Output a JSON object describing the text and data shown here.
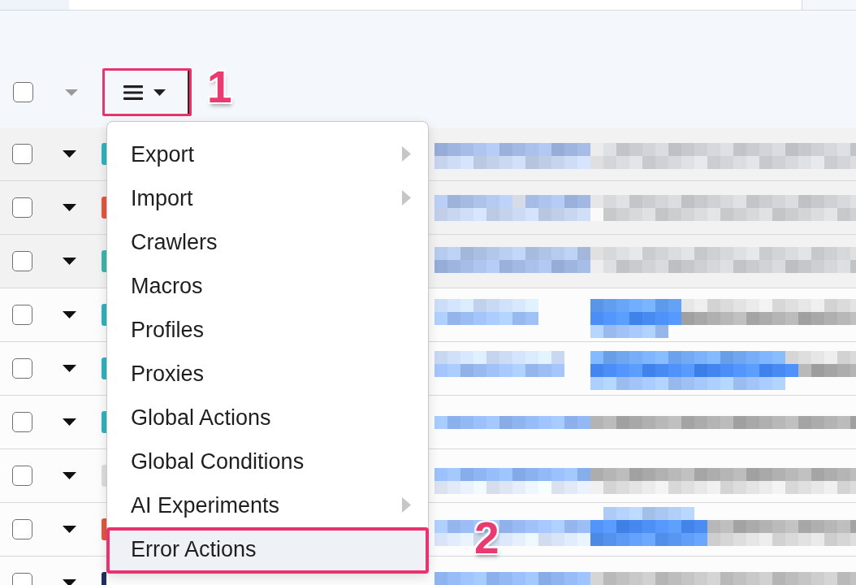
{
  "toolbar": {
    "select_all": {
      "checked": false
    },
    "expand_all": {
      "disabled": true
    },
    "menu_button": {
      "expanded": true,
      "annotation": "1"
    }
  },
  "menu": {
    "items": [
      {
        "label": "Export",
        "submenu": true,
        "selected": false
      },
      {
        "label": "Import",
        "submenu": true,
        "selected": false
      },
      {
        "label": "Crawlers",
        "submenu": false,
        "selected": false
      },
      {
        "label": "Macros",
        "submenu": false,
        "selected": false
      },
      {
        "label": "Profiles",
        "submenu": false,
        "selected": false
      },
      {
        "label": "Proxies",
        "submenu": false,
        "selected": false
      },
      {
        "label": "Global Actions",
        "submenu": false,
        "selected": false
      },
      {
        "label": "Global Conditions",
        "submenu": false,
        "selected": false
      },
      {
        "label": "AI Experiments",
        "submenu": true,
        "selected": false
      },
      {
        "label": "Error Actions",
        "submenu": false,
        "selected": true,
        "annotation": "2"
      }
    ]
  },
  "rows": [
    {
      "checked": false,
      "shaded": true,
      "color": "#2fb3c2"
    },
    {
      "checked": false,
      "shaded": true,
      "color": "#e8553f"
    },
    {
      "checked": false,
      "shaded": true,
      "color": "#3bb7ad"
    },
    {
      "checked": false,
      "shaded": false,
      "color": "#2fb3c2"
    },
    {
      "checked": false,
      "shaded": false,
      "color": "#2fb3c2"
    },
    {
      "checked": false,
      "shaded": false,
      "color": "#2fb3c2"
    },
    {
      "checked": false,
      "shaded": false,
      "color": "#dedede"
    },
    {
      "checked": false,
      "shaded": false,
      "color": "#e8553f"
    },
    {
      "checked": false,
      "shaded": false,
      "color": "#1f2f63"
    }
  ]
}
